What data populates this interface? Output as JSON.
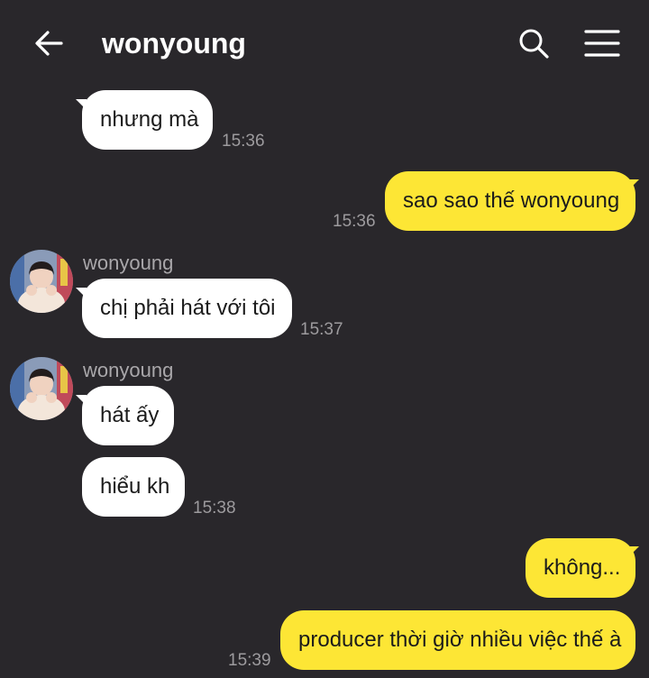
{
  "header": {
    "title": "wonyoung",
    "back_icon": "arrow-left-icon",
    "search_icon": "search-icon",
    "menu_icon": "hamburger-menu-icon"
  },
  "colors": {
    "background": "#29272b",
    "incoming_bubble": "#ffffff",
    "outgoing_bubble": "#fde635",
    "timestamp": "#9d9b9e",
    "sender_name": "#a9a7aa"
  },
  "messages": [
    {
      "direction": "incoming",
      "text": "nhưng mà",
      "time": "15:36"
    },
    {
      "direction": "outgoing",
      "text": "sao sao thế wonyoung",
      "time": "15:36"
    },
    {
      "direction": "incoming",
      "sender": "wonyoung",
      "text": "chị phải hát với tôi",
      "time": "15:37"
    },
    {
      "direction": "incoming",
      "sender": "wonyoung",
      "text": "hát ấy"
    },
    {
      "direction": "incoming",
      "text": "hiểu kh",
      "time": "15:38"
    },
    {
      "direction": "outgoing",
      "text": "không..."
    },
    {
      "direction": "outgoing",
      "text": "producer thời giờ nhiều việc thế à",
      "time": "15:39"
    }
  ]
}
